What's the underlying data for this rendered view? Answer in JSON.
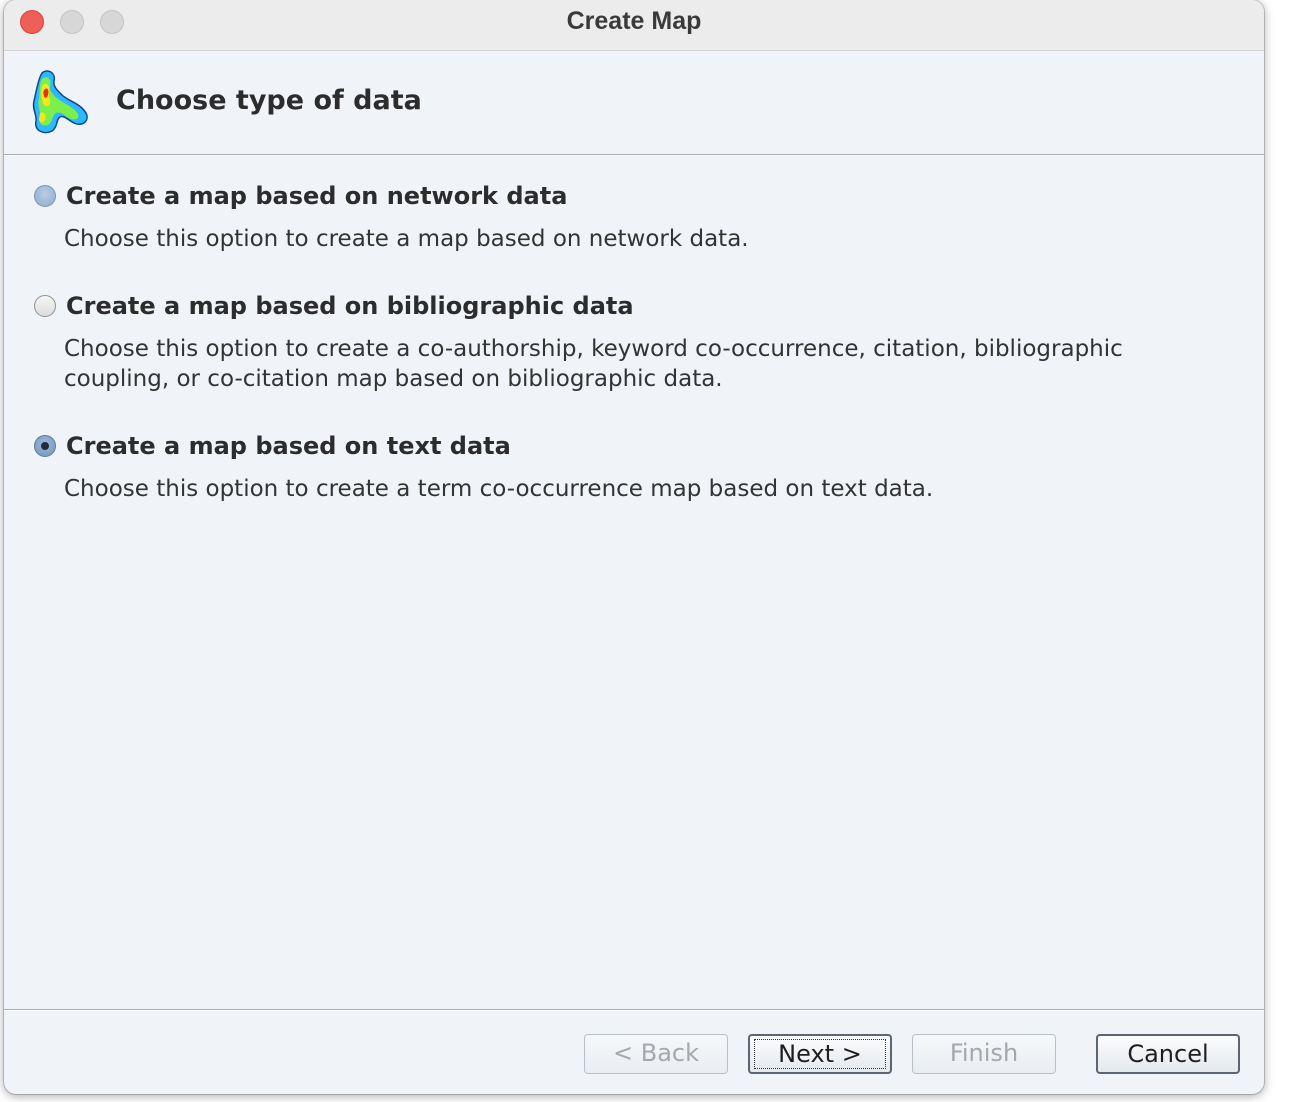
{
  "window": {
    "title": "Create Map"
  },
  "header": {
    "title": "Choose type of data",
    "icon": "vosviewer-logo-icon"
  },
  "options": [
    {
      "label": "Create a map based on network data",
      "description": "Choose this option to create a map based on network data.",
      "selected": false
    },
    {
      "label": "Create a map based on bibliographic data",
      "description": "Choose this option to create a co-authorship, keyword co-occurrence, citation, bibliographic coupling, or co-citation map based on bibliographic data.",
      "selected": false
    },
    {
      "label": "Create a map based on text data",
      "description": "Choose this option to create a term co-occurrence map based on text data.",
      "selected": true
    }
  ],
  "buttons": {
    "back": "< Back",
    "next": "Next >",
    "finish": "Finish",
    "cancel": "Cancel"
  },
  "colors": {
    "window_bg": "#f0f4f8",
    "close": "#ee5f58",
    "inactive_traffic": "#d7d7d7"
  }
}
